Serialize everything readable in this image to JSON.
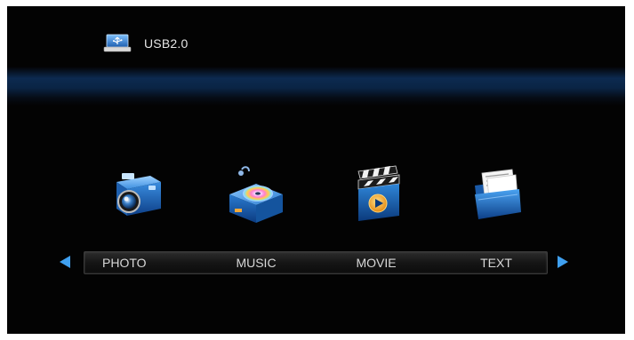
{
  "source": {
    "label": "USB2.0",
    "icon": "usb-drive-icon"
  },
  "menu": {
    "items": [
      {
        "label": "PHOTO",
        "icon": "camera-icon"
      },
      {
        "label": "MUSIC",
        "icon": "music-disc-icon"
      },
      {
        "label": "MOVIE",
        "icon": "film-clapper-icon"
      },
      {
        "label": "TEXT",
        "icon": "document-folder-icon"
      }
    ]
  },
  "navigation": {
    "left": "left-arrow-icon",
    "right": "right-arrow-icon"
  },
  "colors": {
    "background": "#030303",
    "glow_band": "#0c2a50",
    "accent_blue": "#2f86d8",
    "label_text": "#d8d8d8"
  }
}
